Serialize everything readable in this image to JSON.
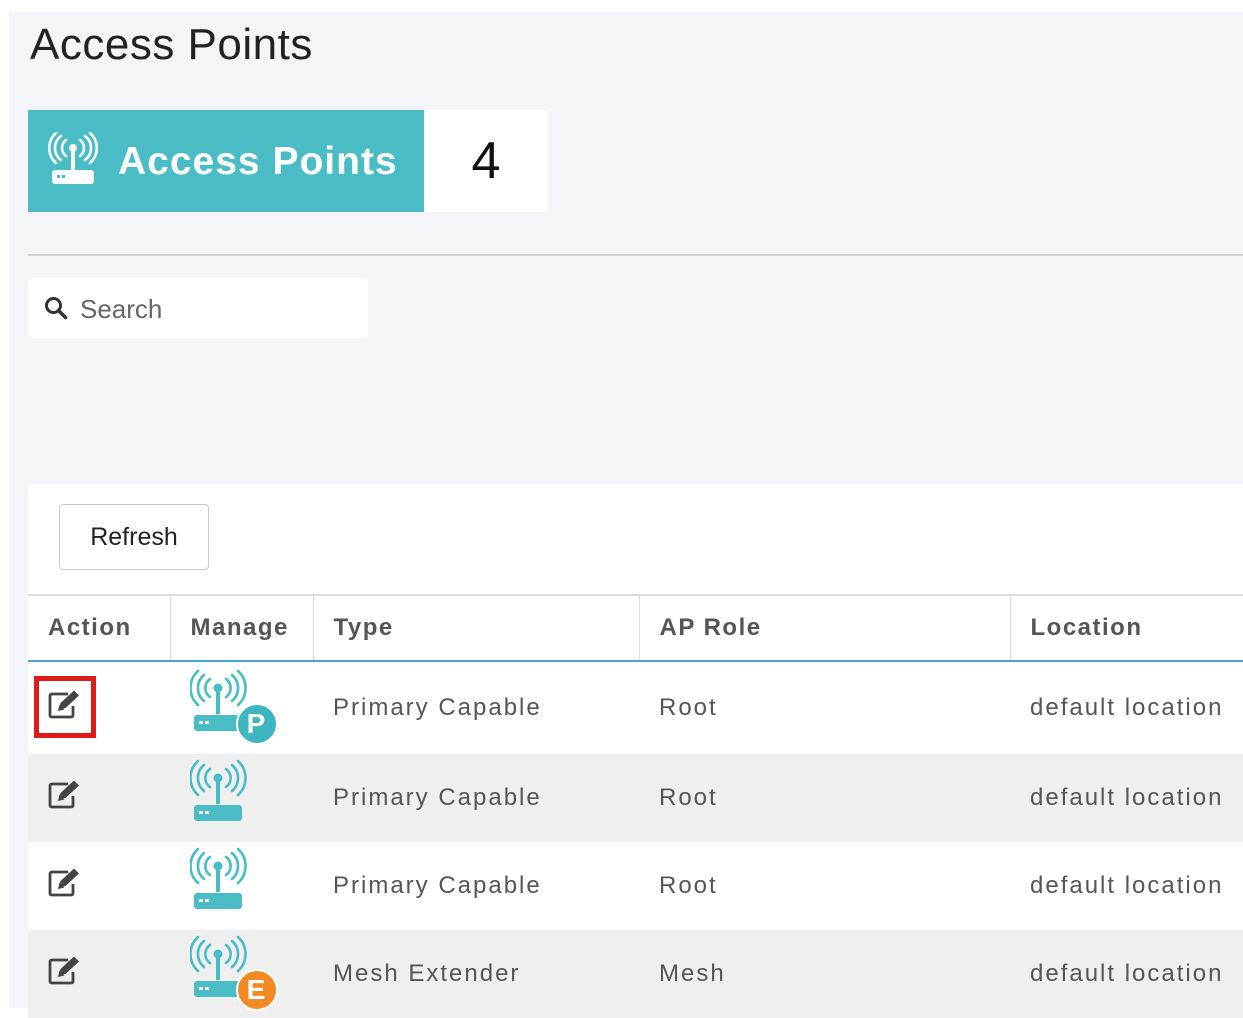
{
  "page": {
    "title": "Access Points"
  },
  "summary": {
    "label": "Access Points",
    "count": "4"
  },
  "search": {
    "placeholder": "Search"
  },
  "toolbar": {
    "refresh_label": "Refresh"
  },
  "table": {
    "columns": [
      "Action",
      "Manage",
      "Type",
      "AP Role",
      "Location"
    ],
    "rows": [
      {
        "type": "Primary Capable",
        "ap_role": "Root",
        "location": "default location",
        "badge": "P",
        "badge_color": "#3fb5c0",
        "selected": true
      },
      {
        "type": "Primary Capable",
        "ap_role": "Root",
        "location": "default location",
        "badge": "",
        "badge_color": "",
        "selected": false
      },
      {
        "type": "Primary Capable",
        "ap_role": "Root",
        "location": "default location",
        "badge": "",
        "badge_color": "",
        "selected": false
      },
      {
        "type": "Mesh Extender",
        "ap_role": "Mesh",
        "location": "default location",
        "badge": "E",
        "badge_color": "#f08a24",
        "selected": false
      }
    ]
  },
  "colors": {
    "accent": "#49bcc6",
    "ap_icon": "#49bcc6",
    "highlight": "#dd1b1b",
    "header_rule": "#4aa3d9"
  },
  "icons": {
    "tile": "access-point-icon",
    "search": "search-icon",
    "edit": "edit-icon",
    "manage": "access-point-icon"
  }
}
